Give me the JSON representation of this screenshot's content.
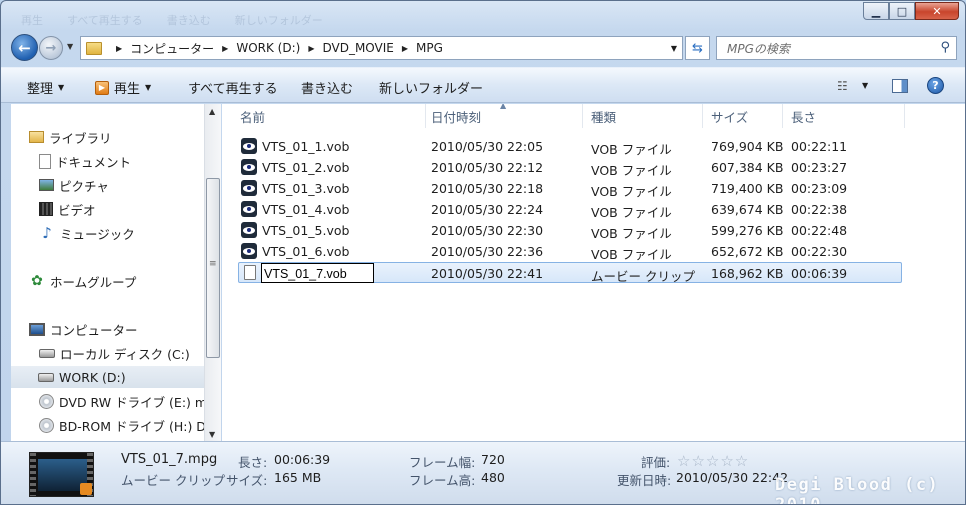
{
  "titlebar": {
    "faded_tabs": [
      "再生",
      "すべて再生する",
      "書き込む",
      "新しいフォルダー"
    ]
  },
  "nav": {
    "breadcrumb": [
      "コンピューター",
      "WORK (D:)",
      "DVD_MOVIE",
      "MPG"
    ],
    "search_placeholder": "MPGの検索"
  },
  "toolbar": {
    "organize": "整理",
    "play": "再生",
    "play_all": "すべて再生する",
    "burn": "書き込む",
    "new_folder": "新しいフォルダー"
  },
  "sidebar": {
    "libraries": "ライブラリ",
    "documents": "ドキュメント",
    "pictures": "ピクチャ",
    "videos": "ビデオ",
    "music": "ミュージック",
    "homegroup": "ホームグループ",
    "computer": "コンピューター",
    "local_disk": "ローカル ディスク (C:)",
    "work": "WORK (D:)",
    "dvd_rw": "DVD RW ドライブ (E:) m",
    "bd_rom": "BD-ROM ドライブ (H:) D"
  },
  "columns": {
    "name": "名前",
    "date": "日付時刻",
    "type": "種類",
    "size": "サイズ",
    "length": "長さ"
  },
  "files": [
    {
      "name": "VTS_01_1.vob",
      "date": "2010/05/30 22:05",
      "type": "VOB ファイル",
      "size": "769,904 KB",
      "length": "00:22:11"
    },
    {
      "name": "VTS_01_2.vob",
      "date": "2010/05/30 22:12",
      "type": "VOB ファイル",
      "size": "607,384 KB",
      "length": "00:23:27"
    },
    {
      "name": "VTS_01_3.vob",
      "date": "2010/05/30 22:18",
      "type": "VOB ファイル",
      "size": "719,400 KB",
      "length": "00:23:09"
    },
    {
      "name": "VTS_01_4.vob",
      "date": "2010/05/30 22:24",
      "type": "VOB ファイル",
      "size": "639,674 KB",
      "length": "00:22:38"
    },
    {
      "name": "VTS_01_5.vob",
      "date": "2010/05/30 22:30",
      "type": "VOB ファイル",
      "size": "599,276 KB",
      "length": "00:22:48"
    },
    {
      "name": "VTS_01_6.vob",
      "date": "2010/05/30 22:36",
      "type": "VOB ファイル",
      "size": "652,672 KB",
      "length": "00:22:30"
    }
  ],
  "selected_file": {
    "rename_value": "VTS_01_7.vob",
    "date": "2010/05/30 22:41",
    "type": "ムービー クリップ",
    "size": "168,962 KB",
    "length": "00:06:39"
  },
  "details": {
    "filename": "VTS_01_7.mpg",
    "filetype": "ムービー クリップ",
    "length_label": "長さ:",
    "length_value": "00:06:39",
    "size_label": "サイズ:",
    "size_value": "165 MB",
    "frame_width_label": "フレーム幅:",
    "frame_width_value": "720",
    "frame_height_label": "フレーム高:",
    "frame_height_value": "480",
    "rating_label": "評価:",
    "rating_stars": "☆☆☆☆☆",
    "modified_label": "更新日時:",
    "modified_value": "2010/05/30 22:42"
  },
  "watermark": "Degi Blood (c) 2010"
}
